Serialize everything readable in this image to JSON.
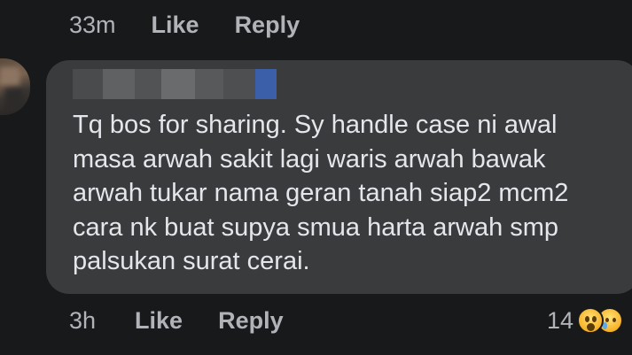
{
  "top_actions": {
    "time": "33m",
    "like_label": "Like",
    "reply_label": "Reply"
  },
  "comment": {
    "author_name_redacted": true,
    "text": "Tq bos for sharing. Sy handle case ni awal\nmasa arwah sakit lagi waris arwah bawak\narwah tukar nama geran tanah siap2 mcm2\ncara nk buat supya smua harta arwah smp\npalsukan surat cerai."
  },
  "bottom_actions": {
    "time": "3h",
    "like_label": "Like",
    "reply_label": "Reply"
  },
  "reactions": {
    "count": "14",
    "types": [
      "wow-icon",
      "sad-icon"
    ]
  },
  "colors": {
    "background": "#18191a",
    "bubble": "#3a3b3c",
    "text": "#e4e6eb",
    "secondary_text": "#b0b3b8"
  }
}
